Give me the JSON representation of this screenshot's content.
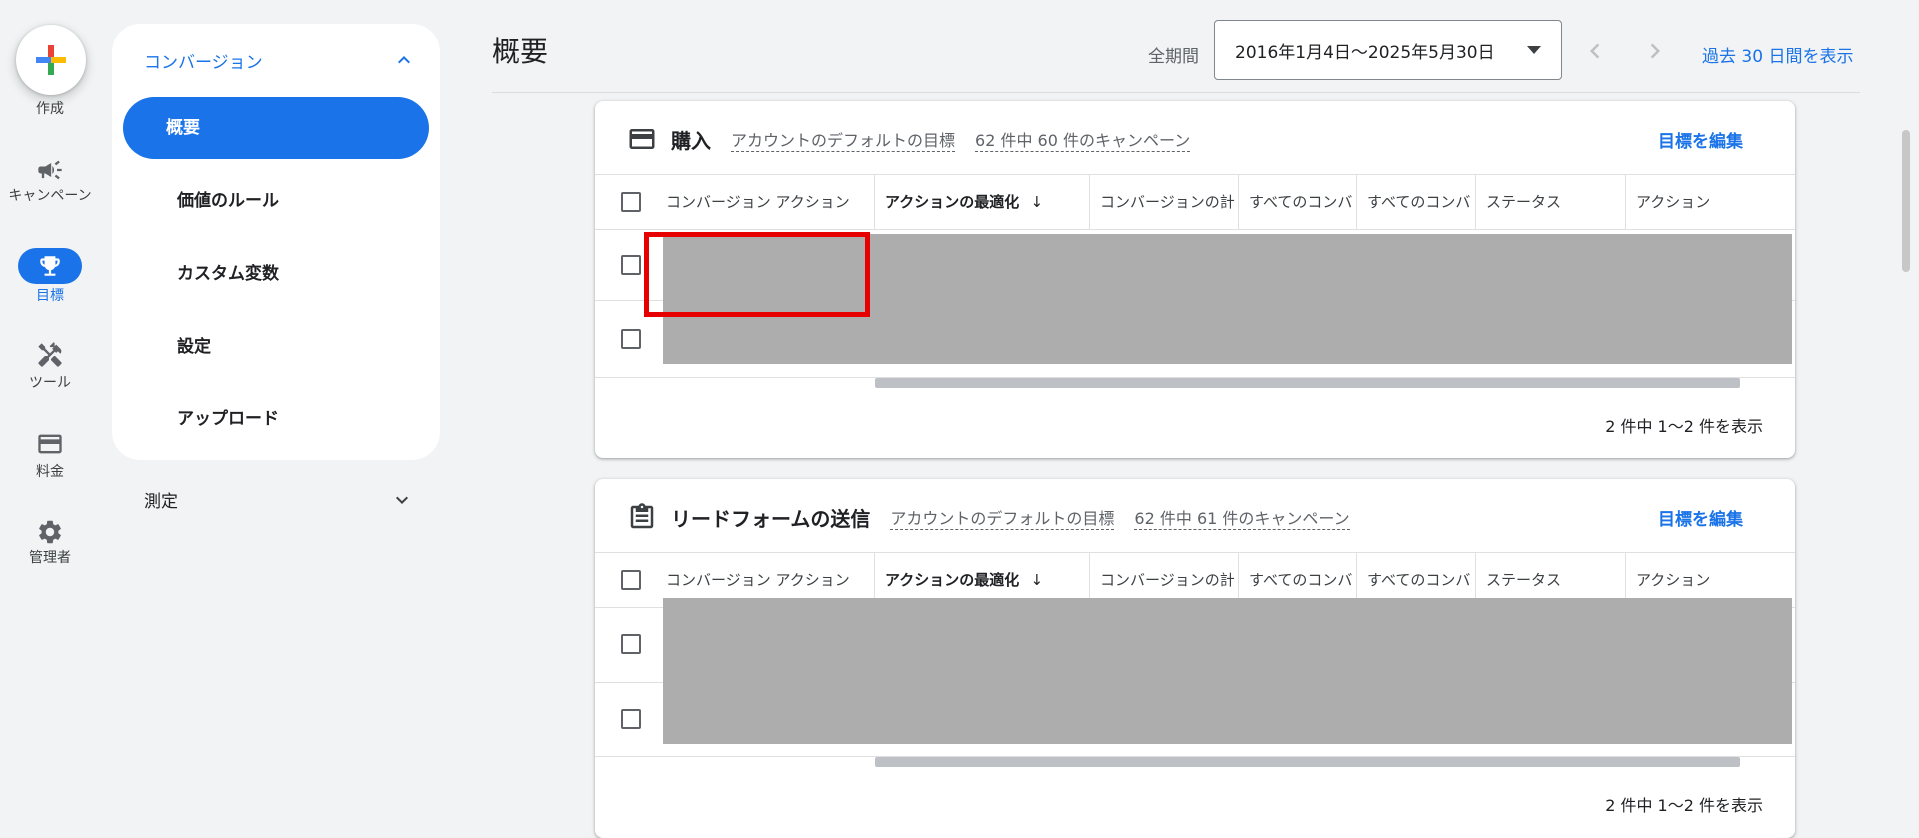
{
  "rail": {
    "create_label": "作成",
    "items": [
      {
        "label": "キャンペーン",
        "icon": "megaphone-icon"
      },
      {
        "label": "目標",
        "icon": "trophy-icon",
        "active": true
      },
      {
        "label": "ツール",
        "icon": "tools-icon"
      },
      {
        "label": "料金",
        "icon": "credit-card-icon"
      },
      {
        "label": "管理者",
        "icon": "gear-icon"
      }
    ]
  },
  "subnav": {
    "section_title": "コンバージョン",
    "items": [
      {
        "label": "概要",
        "active": true
      },
      {
        "label": "価値のルール"
      },
      {
        "label": "カスタム変数"
      },
      {
        "label": "設定"
      },
      {
        "label": "アップロード"
      }
    ],
    "collapsed_section": "測定"
  },
  "header": {
    "title": "概要",
    "period_label": "全期間",
    "date_range": "2016年1月4日〜2025年5月30日",
    "last30_link": "過去 30 日間を表示"
  },
  "cards": [
    {
      "title": "購入",
      "icon": "credit-card-icon",
      "default_goal": "アカウントのデフォルトの目標",
      "campaigns": "62 件中 60 件のキャンペーン",
      "edit_goal": "目標を編集",
      "columns": [
        "コンバージョン アクション",
        "アクションの最適化",
        "コンバージョンの計",
        "すべてのコンバ",
        "すべてのコンバ",
        "ステータス",
        "アクション"
      ],
      "pager": "2 件中 1〜2 件を表示"
    },
    {
      "title": "リードフォームの送信",
      "icon": "clipboard-icon",
      "default_goal": "アカウントのデフォルトの目標",
      "campaigns": "62 件中 61 件のキャンペーン",
      "edit_goal": "目標を編集",
      "columns": [
        "コンバージョン アクション",
        "アクションの最適化",
        "コンバージョンの計",
        "すべてのコンバ",
        "すべてのコンバ",
        "ステータス",
        "アクション"
      ],
      "pager": "2 件中 1〜2 件を表示"
    }
  ],
  "colors": {
    "accent": "#1a73e8",
    "redaction": "#adadad",
    "highlight": "#e60000"
  }
}
